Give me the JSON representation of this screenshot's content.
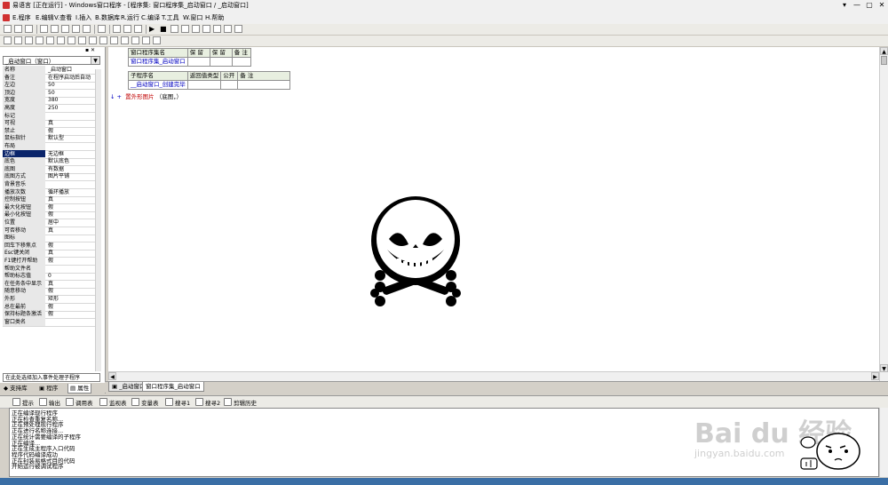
{
  "window": {
    "title": "易语言 [正在运行] - Windows窗口程序 - [程序集: 窗口程序集_启动窗口 / _启动窗口]",
    "controls": [
      "▾",
      "—",
      "▢",
      "✕"
    ]
  },
  "menu": [
    {
      "label": "E.程序"
    },
    {
      "label": "E.编辑"
    },
    {
      "label": "V.查看"
    },
    {
      "label": "I.插入"
    },
    {
      "label": "B.数据库"
    },
    {
      "label": "R.运行"
    },
    {
      "label": "C.编译"
    },
    {
      "label": "T.工具"
    },
    {
      "label": "W.窗口"
    },
    {
      "label": "H.帮助"
    }
  ],
  "left_panel": {
    "combo_value": "_启动窗口（窗口）",
    "properties": [
      {
        "name": "名称",
        "value": "_启动窗口"
      },
      {
        "name": "备注",
        "value": "在程序启动后自动"
      },
      {
        "name": "左边",
        "value": "50"
      },
      {
        "name": "顶边",
        "value": "50"
      },
      {
        "name": "宽度",
        "value": "380"
      },
      {
        "name": "高度",
        "value": "250"
      },
      {
        "name": "标记",
        "value": ""
      },
      {
        "name": "可视",
        "value": "真"
      },
      {
        "name": "禁止",
        "value": "假"
      },
      {
        "name": "鼠标指针",
        "value": "默认型"
      },
      {
        "name": "布局",
        "value": ""
      },
      {
        "name": "边框",
        "value": "无边框"
      },
      {
        "name": "底色",
        "value": "默认底色"
      },
      {
        "name": "底图",
        "value": "有数据"
      },
      {
        "name": "  底图方式",
        "value": "图片平铺"
      },
      {
        "name": "背景音乐",
        "value": ""
      },
      {
        "name": "  播放次数",
        "value": "循环播放"
      },
      {
        "name": "控制按钮",
        "value": "真"
      },
      {
        "name": "  最大化按钮",
        "value": "假"
      },
      {
        "name": "  最小化按钮",
        "value": "假"
      },
      {
        "name": "位置",
        "value": "居中"
      },
      {
        "name": "可否移动",
        "value": "真"
      },
      {
        "name": "图标",
        "value": ""
      },
      {
        "name": "回车下移焦点",
        "value": "假"
      },
      {
        "name": "Esc键关闭",
        "value": "真"
      },
      {
        "name": "F1键打开帮助",
        "value": "假"
      },
      {
        "name": "  帮助文件名",
        "value": ""
      },
      {
        "name": "  帮助标志值",
        "value": "0"
      },
      {
        "name": "在任务条中显示",
        "value": "真"
      },
      {
        "name": "随意移动",
        "value": "假"
      },
      {
        "name": "外形",
        "value": "矩形"
      },
      {
        "name": "总在最前",
        "value": "假"
      },
      {
        "name": "保持标题条激活",
        "value": "假"
      },
      {
        "name": "窗口类名",
        "value": ""
      }
    ],
    "selected_property": "边框",
    "event_combo": "在此处选择加入事件处理子程序",
    "tabs": [
      "支持库",
      "程序",
      "属性"
    ]
  },
  "editor": {
    "class_table": {
      "headers": [
        "窗口程序集名",
        "保 留",
        "保 留",
        "备 注"
      ],
      "row": [
        "窗口程序集_启动窗口",
        "",
        "",
        ""
      ]
    },
    "sub_table": {
      "headers": [
        "子程序名",
        "返回值类型",
        "公开",
        "备 注"
      ],
      "row": [
        "__启动窗口_创建完毕",
        "",
        "",
        ""
      ]
    },
    "code_marks": "↓ +",
    "code_func": "置外形图片",
    "code_args": "（底图，）",
    "tabs": [
      "_启动窗口",
      "窗口程序集_启动窗口"
    ]
  },
  "bottom": {
    "tabs": [
      "提示",
      "输出",
      "调用表",
      "监视表",
      "变量表",
      "搜寻1",
      "搜寻2",
      "剪辑历史"
    ],
    "output_lines": [
      "正在编译现行程序",
      "正在检查重复名称...",
      "正在预处理现行程序",
      "正在进行名称连接...",
      "正在统计需要编译的子程序",
      "正在编译...",
      "正在生成主程序入口代码",
      "程序代码编译成功",
      "正在封装易格式目的代码",
      "开始运行被调试程序"
    ]
  },
  "watermark": {
    "brand": "Bai du 经验",
    "url": "jingyan.baidu.com"
  },
  "colors": {
    "selected": "#0a246a",
    "accent_blue": "#0000c0",
    "code_red": "#c00000"
  }
}
